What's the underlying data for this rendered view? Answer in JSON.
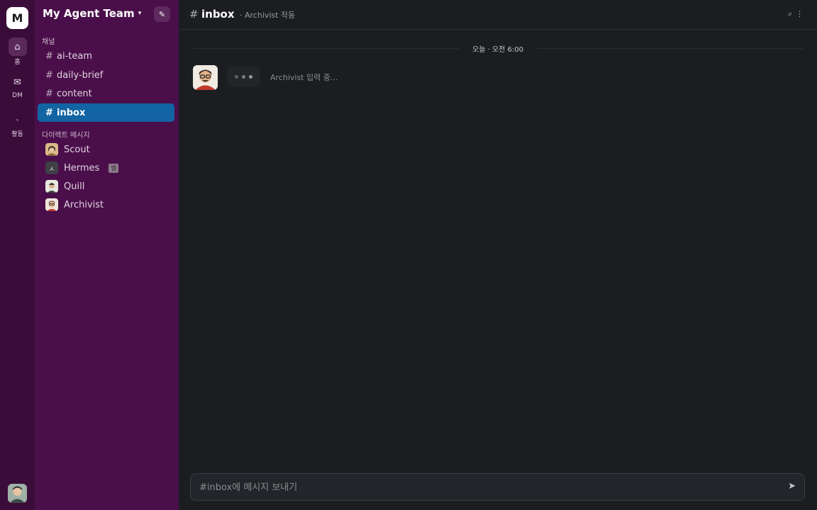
{
  "rail": {
    "workspace_initial": "M",
    "items": [
      {
        "icon": "home-icon",
        "glyph": "⌂",
        "label": "홈"
      },
      {
        "icon": "mail-icon",
        "glyph": "✉",
        "label": "DM"
      },
      {
        "icon": "activity-icon",
        "glyph": "˴",
        "label": "활동"
      }
    ]
  },
  "sidebar": {
    "workspace_name": "My Agent Team",
    "workspace_caret": "▾",
    "compose_glyph": "✎",
    "channels_title": "채널",
    "channels": [
      {
        "label": "ai-team"
      },
      {
        "label": "daily-brief"
      },
      {
        "label": "content"
      },
      {
        "label": "inbox",
        "active": true
      }
    ],
    "dm_title": "다이렉트 메시지",
    "dms": [
      {
        "label": "Scout"
      },
      {
        "label": "Hermes",
        "initial": "ㅅ",
        "badge": "앱"
      },
      {
        "label": "Quill"
      },
      {
        "label": "Archivist"
      }
    ]
  },
  "header": {
    "hash": "#",
    "channel": "inbox",
    "subtitle": "· Archivist 작동",
    "search_glyph": "⌕",
    "more_glyph": "⋮"
  },
  "messages": {
    "date_divider": "오늘 · 오전 6:00",
    "typing_text": "Archivist 입력 중..."
  },
  "composer": {
    "placeholder": "#inbox에 메시지 보내기",
    "send_glyph": "➤"
  },
  "colors": {
    "rail": "#3a0c3a",
    "sidebar": "#4a0f4a",
    "active_channel": "#1264a3",
    "main_bg": "#1b1d21"
  }
}
